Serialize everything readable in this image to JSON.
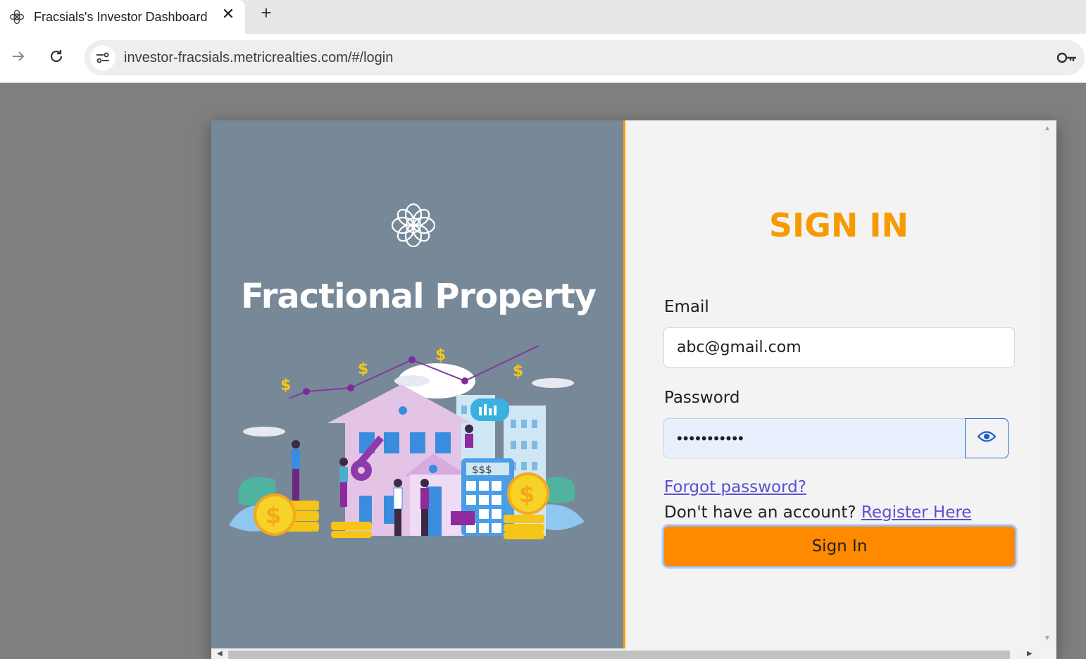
{
  "browser": {
    "tab_title": "Fracsials's Investor Dashboard",
    "tab_close": "✕",
    "new_tab": "+",
    "url": "investor-fracsials.metricrealties.com/#/login"
  },
  "brand": {
    "title": "Fractional Property"
  },
  "form": {
    "heading": "SIGN IN",
    "email_label": "Email",
    "email_value": "abc@gmail.com",
    "password_label": "Password",
    "password_value": "•••••••••••",
    "forgot_link": "Forgot password?",
    "no_account_text": "Don't have an account? ",
    "register_link": "Register Here",
    "submit_label": "Sign In"
  },
  "colors": {
    "left_panel": "#778899",
    "accent_divider": "#f5a300",
    "heading": "#f79a00",
    "button": "#ff8a00",
    "link": "#5b4fcf"
  }
}
